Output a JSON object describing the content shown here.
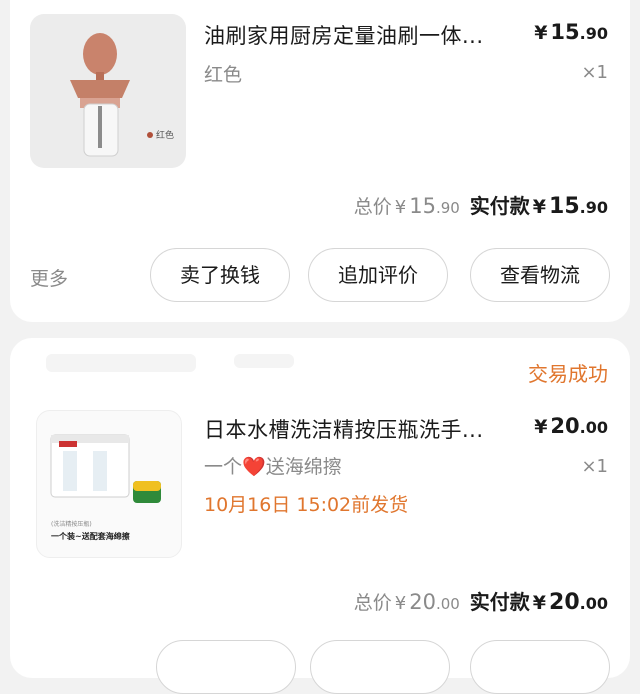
{
  "orders": [
    {
      "title": "油刷家用厨房定量油刷一体...",
      "price_currency": "¥",
      "price_int": "15",
      "price_dec": ".90",
      "spec": "红色",
      "qty": "×1",
      "thumb_tag": "红色",
      "total_label": "总价",
      "total_int": "15",
      "total_dec": ".90",
      "paid_label": "实付款",
      "paid_int": "15",
      "paid_dec": ".90",
      "more_label": "更多",
      "buttons": [
        "卖了换钱",
        "追加评价",
        "查看物流"
      ]
    },
    {
      "status": "交易成功",
      "title": "日本水槽洗洁精按压瓶洗手...",
      "price_currency": "¥",
      "price_int": "20",
      "price_dec": ".00",
      "spec_pre": "一个",
      "spec_heart": "❤️",
      "spec_post": "送海绵擦",
      "qty": "×1",
      "ship_note": "10月16日 15:02前发货",
      "thumb_caption_small": "(洗洁精按压瓶)",
      "thumb_caption": "一个装~送配套海绵擦",
      "total_label": "总价",
      "total_int": "20",
      "total_dec": ".00",
      "paid_label": "实付款",
      "paid_int": "20",
      "paid_dec": ".00"
    }
  ],
  "colors": {
    "accent_orange": "#e0762e",
    "heart_red": "#e02020",
    "muted_text": "#8a8a8a",
    "background": "#f2f2f2"
  }
}
